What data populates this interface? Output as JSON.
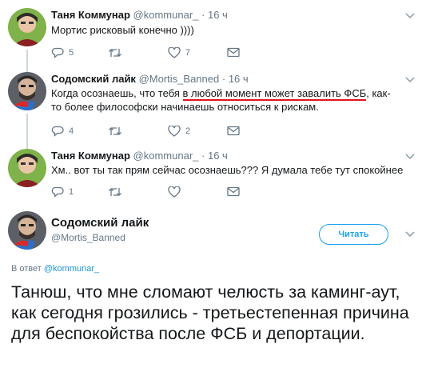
{
  "tweets": [
    {
      "name": "Таня Коммунар",
      "handle": "@kommunar_",
      "time": "16 ч",
      "text": "Мортис рисковый конечно ))))",
      "replies": "5",
      "retweets": "",
      "likes": "7"
    },
    {
      "name": "Содомский лайк",
      "handle": "@Mortis_Banned",
      "time": "16 ч",
      "text_before": "Когда осознаешь, что тебя ",
      "text_underlined": "в любой момент может завалить ФСБ",
      "text_after": ", как-то более философски начинаешь относиться к рискам.",
      "replies": "4",
      "retweets": "",
      "likes": "2"
    },
    {
      "name": "Таня Коммунар",
      "handle": "@kommunar_",
      "time": "16 ч",
      "text": "Хм.. вот ты так прям сейчас осознаешь??? Я думала тебе тут спокойнее",
      "replies": "1",
      "retweets": "",
      "likes": ""
    }
  ],
  "main_tweet": {
    "name": "Содомский лайк",
    "handle": "@Mortis_Banned",
    "follow_label": "Читать",
    "reply_prefix": "В ответ",
    "reply_mention": "@kommunar_",
    "text": "Танюш, что мне сломают челюсть за каминг-аут, как сегодня грозились - третьестепенная причина для беспокойства после ФСБ и депортации."
  },
  "colors": {
    "accent": "#1da1f2",
    "muted": "#657786",
    "highlight_underline": "#e0141e",
    "thread_line": "#ccd6dd"
  }
}
